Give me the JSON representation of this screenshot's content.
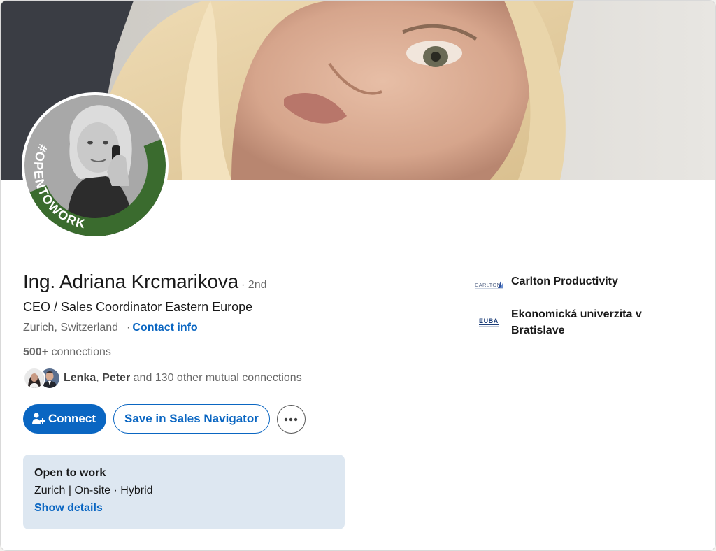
{
  "profile": {
    "name": "Ing. Adriana Krcmarikova",
    "degree": "· 2nd",
    "headline": "CEO / Sales Coordinator Eastern Europe",
    "location": "Zurich, Switzerland",
    "contact_sep": "·",
    "contact_label": "Contact info",
    "connections_count": "500+",
    "connections_label": "connections",
    "open_to_work_badge": "#OPENTOWORK"
  },
  "mutual": {
    "name1": "Lenka",
    "sep": ",",
    "name2": "Peter",
    "rest": "and 130 other mutual connections"
  },
  "actions": {
    "connect_label": "Connect",
    "save_label": "Save in Sales Navigator"
  },
  "open_to_work": {
    "title": "Open to work",
    "detail": "Zurich | On-site · Hybrid",
    "link": "Show details"
  },
  "experience": [
    {
      "name": "Carlton Productivity",
      "logo_text": "CARLTON"
    },
    {
      "name": "Ekonomická univerzita v Bratislave",
      "logo_text": "EUBA"
    }
  ],
  "colors": {
    "brand_blue": "#0a66c2",
    "open_to_work_green": "#3a6b2e",
    "otw_card_bg": "#dde7f1"
  }
}
